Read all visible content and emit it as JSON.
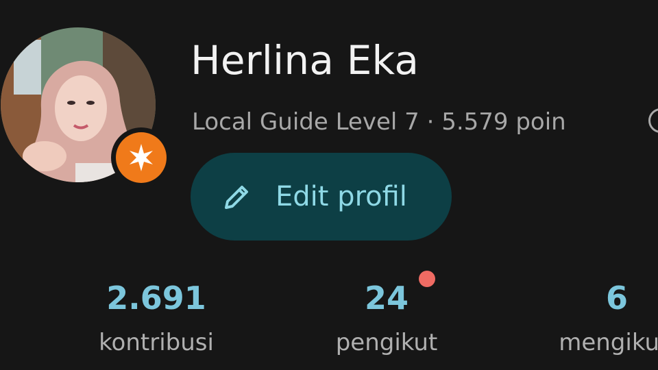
{
  "profile": {
    "name": "Herlina Eka",
    "subtitle": "Local Guide Level 7 · 5.579 poin",
    "edit_label": "Edit profil"
  },
  "stats": [
    {
      "value": "2.691",
      "label": "kontribusi"
    },
    {
      "value": "24",
      "label": "pengikut"
    },
    {
      "value": "6",
      "label": "mengikuti"
    }
  ],
  "icons": {
    "badge": "local-guide-star-icon",
    "edit": "pencil-icon",
    "info": "info-icon",
    "notification": "notification-dot"
  },
  "colors": {
    "background": "#161616",
    "accent": "#7cc6dc",
    "button_bg": "#0d3f45",
    "badge": "#f07a1a",
    "dot": "#ef6b63"
  }
}
